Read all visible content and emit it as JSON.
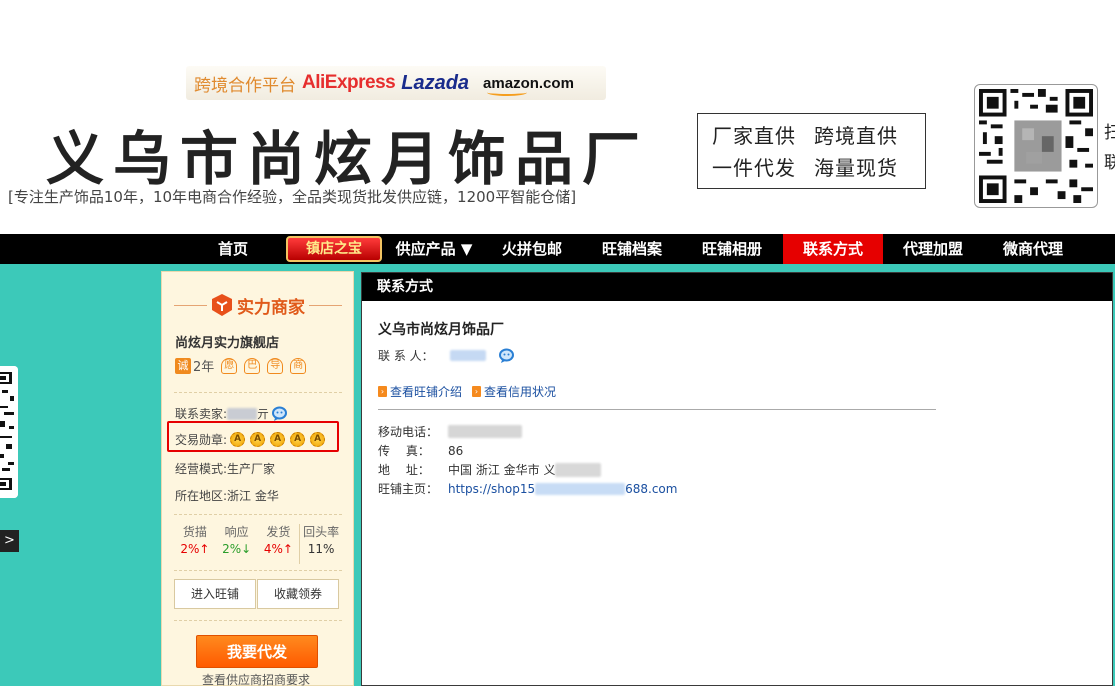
{
  "header": {
    "partner_label": "跨境合作平台",
    "partner_aliexpress": "AliExpress",
    "partner_lazada": "Lazada",
    "partner_amazon": "amazon.com",
    "company_title": "义乌市尚炫月饰品厂",
    "slogan": "[专注生产饰品10年，10年电商合作经验，全品类现货批发供应链，1200平智能仓储]",
    "promo_lines": [
      [
        "厂家直供",
        "跨境直供"
      ],
      [
        "一件代发",
        "海量现货"
      ]
    ],
    "qr_side_text": [
      "扫",
      "联"
    ]
  },
  "nav": {
    "items": [
      "首页",
      "镇店之宝",
      "供应产品 ▼",
      "火拼包邮",
      "旺铺档案",
      "旺铺相册",
      "联系方式",
      "代理加盟",
      "微商代理"
    ],
    "active_index": 6
  },
  "sidebar": {
    "brand": "实力商家",
    "shop_name": "尚炫月实力旗舰店",
    "year_icon": "诚",
    "years": "2年",
    "service_badges": [
      "愿",
      "巴",
      "导",
      "商"
    ],
    "seller_label": "联系卖家:",
    "seller_tail": "亓",
    "medal_label": "交易勋章:",
    "medal_icon": "A",
    "medal_count": 5,
    "mode_label": "经营模式:",
    "mode_value": "生产厂家",
    "region_label": "所在地区:",
    "region_value": "浙江 金华",
    "stats": [
      {
        "label": "货描",
        "value": "2%↑",
        "trend": "up"
      },
      {
        "label": "响应",
        "value": "2%↓",
        "trend": "down"
      },
      {
        "label": "发货",
        "value": "4%↑",
        "trend": "up"
      },
      {
        "label": "回头率",
        "value": "11%",
        "trend": "none"
      }
    ],
    "btn_enter_shop": "进入旺铺",
    "btn_collect": "收藏领券",
    "btn_daifa": "我要代发",
    "footnote": "查看供应商招商要求"
  },
  "main": {
    "title": "联系方式",
    "company": "义乌市尚炫月饰品厂",
    "contact_label": "联 系 人：",
    "link_intro": "查看旺铺介绍",
    "link_credit": "查看信用状况",
    "mobile_label": "移动电话：",
    "fax_label": "传　 真：",
    "fax_value": "86",
    "address_label": "地　 址：",
    "address_value": "中国 浙江 金华市 义",
    "homepage_label": "旺铺主页：",
    "homepage_prefix": "https://shop15",
    "homepage_suffix": "688.com"
  },
  "colors": {
    "teal": "#3cc9b9",
    "nav_active": "#e60000",
    "brand_orange": "#ff6a00"
  }
}
